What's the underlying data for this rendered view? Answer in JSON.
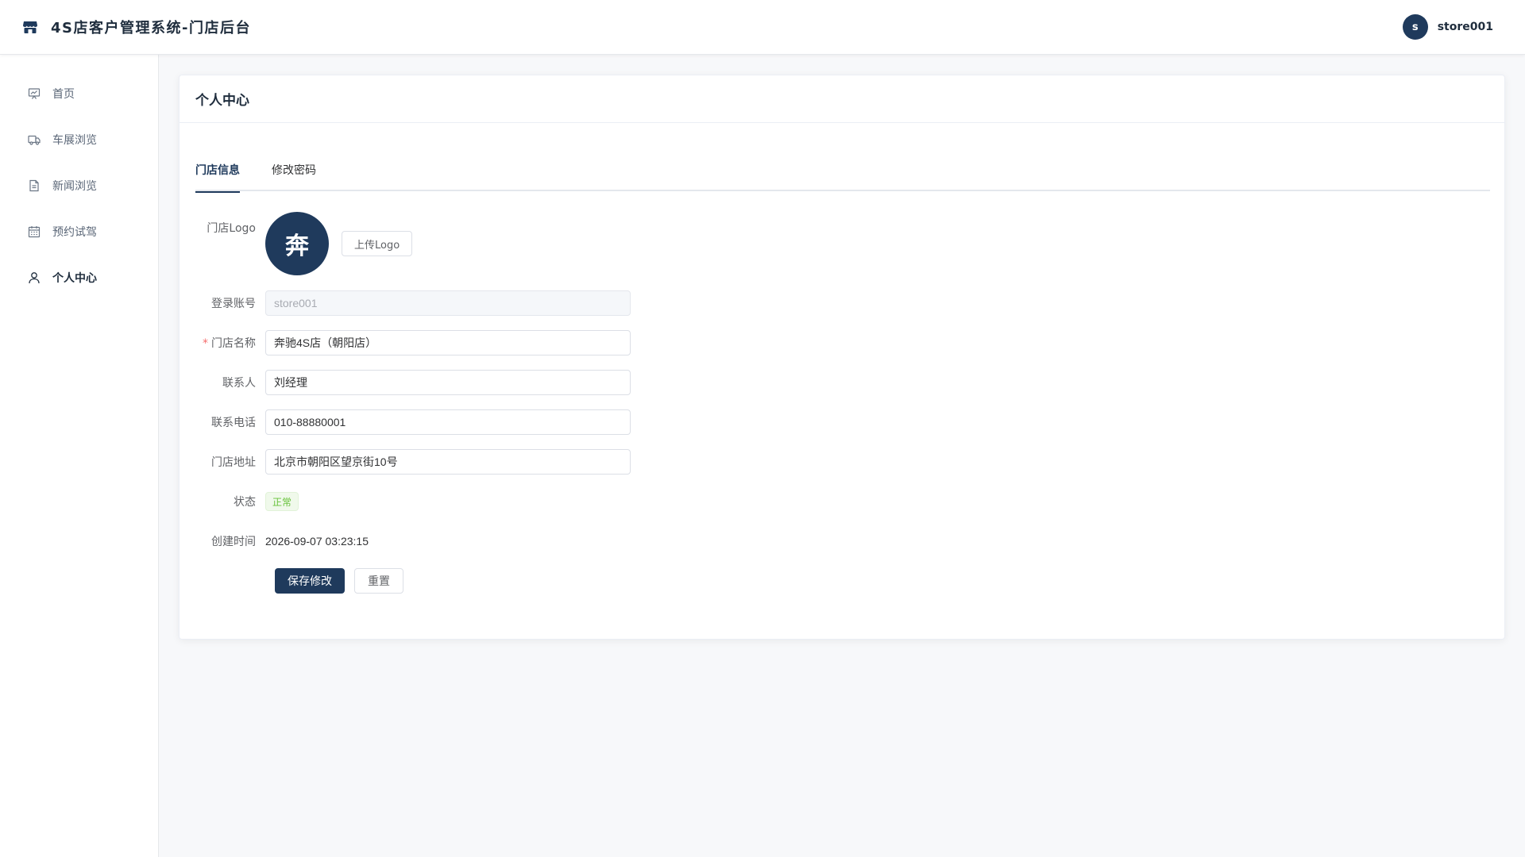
{
  "header": {
    "title": "4S店客户管理系统-门店后台",
    "user_initial": "s",
    "user_name": "store001"
  },
  "sidebar": {
    "items": [
      {
        "label": "首页",
        "icon": "presentation-chart-icon"
      },
      {
        "label": "车展浏览",
        "icon": "truck-icon"
      },
      {
        "label": "新闻浏览",
        "icon": "document-icon"
      },
      {
        "label": "预约试驾",
        "icon": "calendar-icon"
      },
      {
        "label": "个人中心",
        "icon": "user-icon",
        "active": true
      }
    ]
  },
  "page": {
    "title": "个人中心",
    "tabs": [
      {
        "label": "门店信息",
        "active": true
      },
      {
        "label": "修改密码",
        "active": false
      }
    ]
  },
  "form": {
    "logo_label": "门店Logo",
    "logo_char": "奔",
    "upload_label": "上传Logo",
    "account_label": "登录账号",
    "account_value": "store001",
    "store_name_label": "门店名称",
    "store_name_required": "*",
    "store_name_value": "奔驰4S店（朝阳店）",
    "contact_label": "联系人",
    "contact_value": "刘经理",
    "phone_label": "联系电话",
    "phone_value": "010-88880001",
    "address_label": "门店地址",
    "address_value": "北京市朝阳区望京街10号",
    "status_label": "状态",
    "status_value": "正常",
    "created_label": "创建时间",
    "created_value": "2026-09-07 03:23:15",
    "save_label": "保存修改",
    "reset_label": "重置"
  },
  "colors": {
    "primary": "#1f3a5c",
    "success": "#67c23a",
    "danger": "#f56c6c"
  }
}
